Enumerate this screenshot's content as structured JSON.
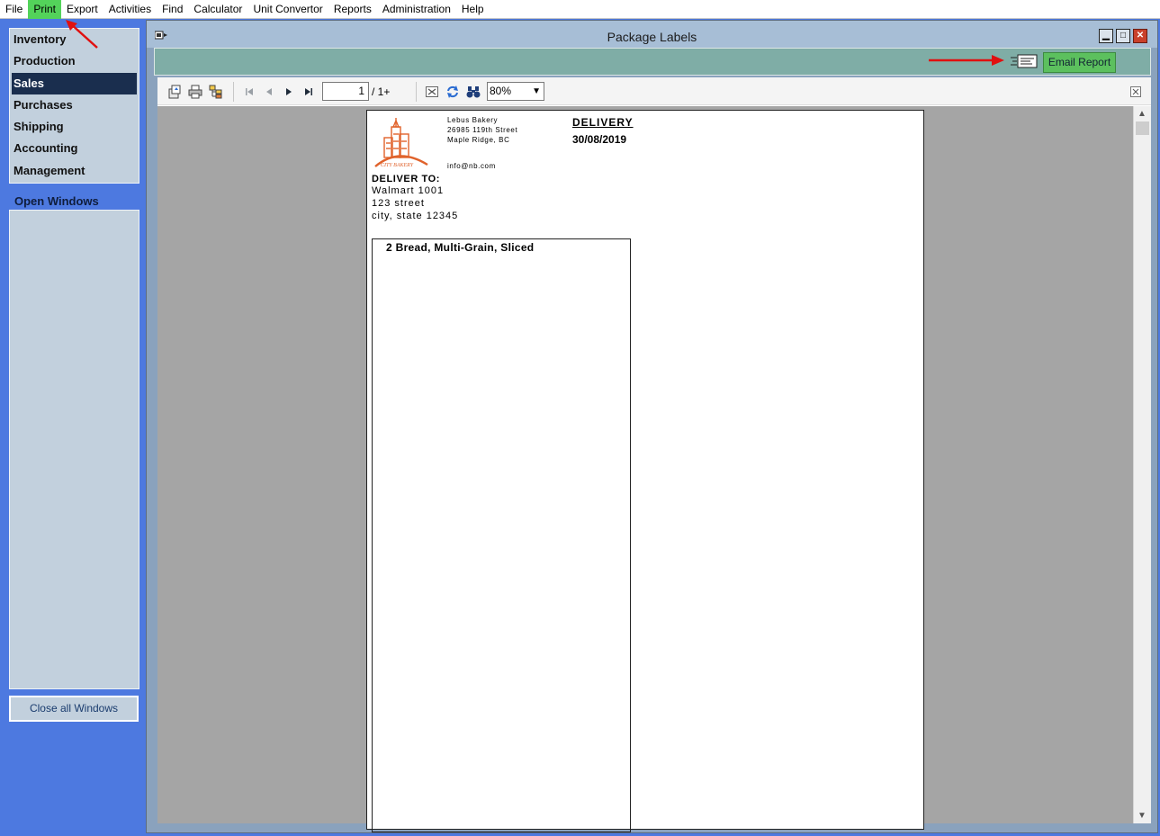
{
  "menu": [
    "File",
    "Print",
    "Export",
    "Activities",
    "Find",
    "Calculator",
    "Unit Convertor",
    "Reports",
    "Administration",
    "Help"
  ],
  "sidebar": {
    "items": [
      "Inventory",
      "Production",
      "Sales",
      "Purchases",
      "Shipping",
      "Accounting",
      "Management"
    ],
    "selected": "Sales",
    "open_windows_label": "Open Windows",
    "close_all_label": "Close all Windows"
  },
  "window": {
    "title": "Package Labels",
    "email_button": "Email Report"
  },
  "toolbar": {
    "page_value": "1",
    "page_total": "/ 1+",
    "zoom": "80%"
  },
  "report": {
    "company_line1": "Lebus Bakery",
    "company_line2": "26985 119th Street",
    "company_line3": "Maple Ridge, BC",
    "email": "info@nb.com",
    "heading": "DELIVERY",
    "date": "30/08/2019",
    "deliver_to_label": "DELIVER TO:",
    "address_line1": "Walmart 1001",
    "address_line2": "123 street",
    "address_line3": "city, state  12345",
    "item": "2  Bread, Multi-Grain, Sliced",
    "logo_text": "CITY BAKERY"
  },
  "colors": {
    "sidebar_bg": "#4d79e0",
    "selected_nav": "#1a2e4e",
    "menu_highlight": "#53d35a",
    "email_button": "#5cc05e",
    "annotation_arrow": "#e01010"
  }
}
